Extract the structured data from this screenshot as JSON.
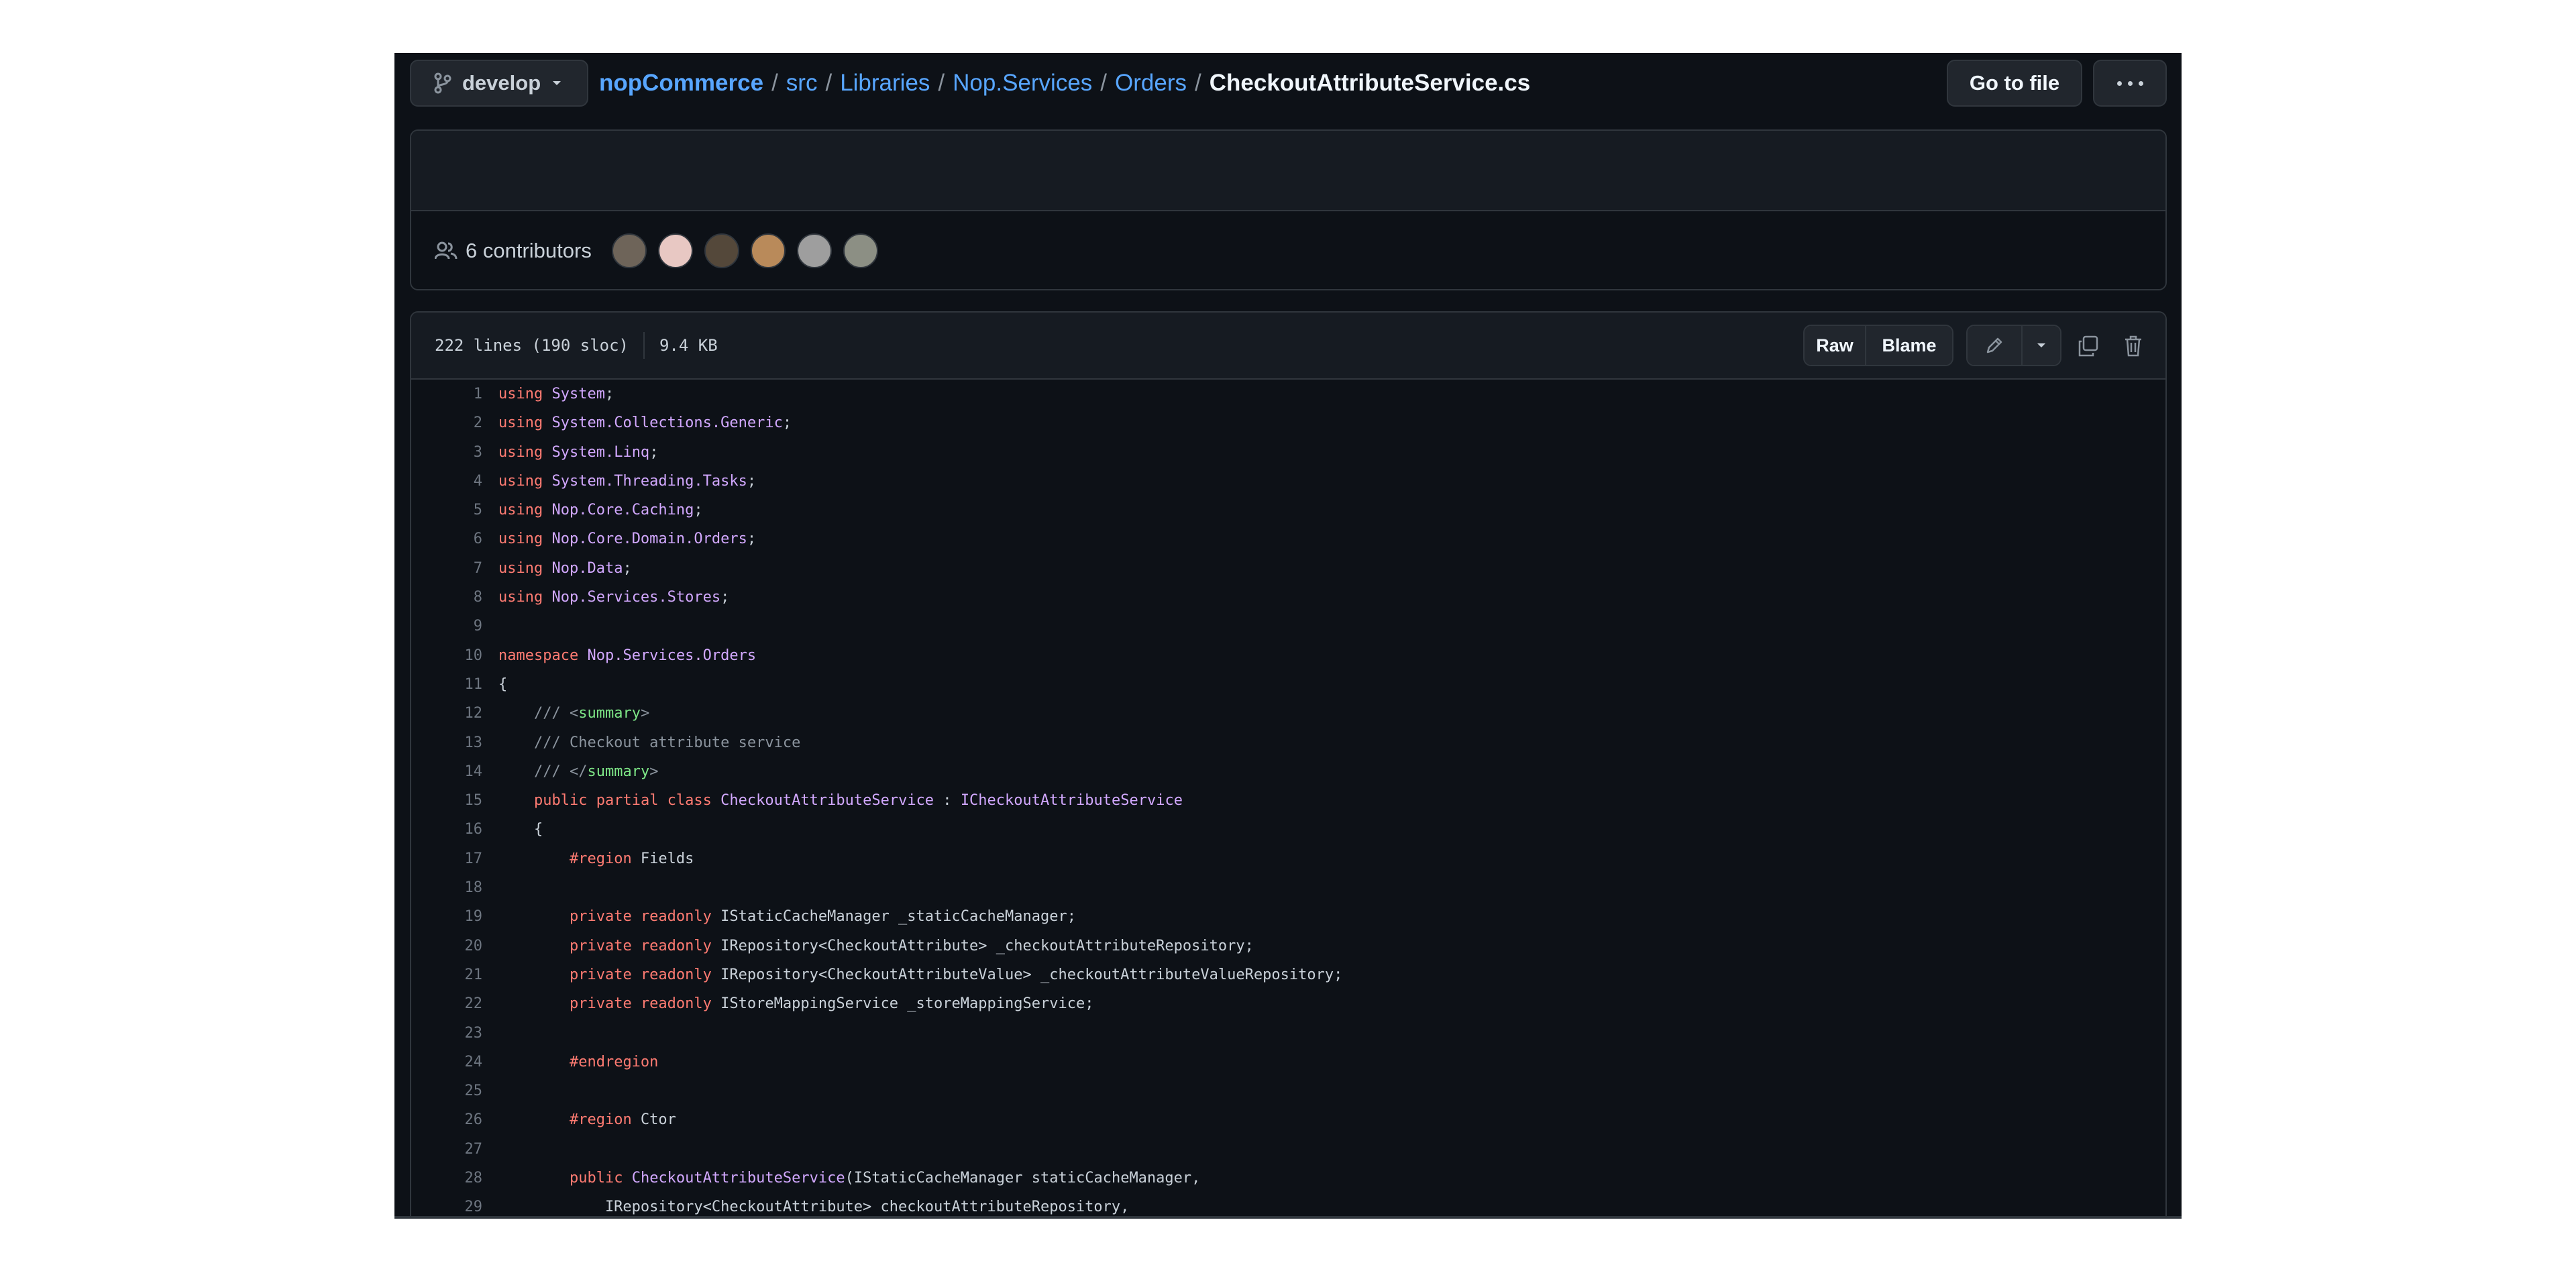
{
  "branch": {
    "name": "develop"
  },
  "breadcrumb": {
    "repo": "nopCommerce",
    "separator": "/",
    "folders": [
      "src",
      "Libraries",
      "Nop.Services",
      "Orders"
    ],
    "file": "CheckoutAttributeService.cs"
  },
  "actions": {
    "goto_file": "Go to file",
    "more": "more-options-icon"
  },
  "contributors": {
    "label": "6 contributors",
    "avatars": [
      "#6e6459",
      "#e8c8c3",
      "#54483a",
      "#b98a5a",
      "#9e9e9e",
      "#8c8f84"
    ]
  },
  "file": {
    "lines_info": "222 lines (190 sloc)",
    "size": "9.4 KB",
    "raw_label": "Raw",
    "blame_label": "Blame"
  },
  "code": [
    {
      "n": "1",
      "tokens": [
        {
          "t": "using",
          "c": "k"
        },
        {
          "t": " "
        },
        {
          "t": "System",
          "c": "n"
        },
        {
          "t": ";"
        }
      ]
    },
    {
      "n": "2",
      "tokens": [
        {
          "t": "using",
          "c": "k"
        },
        {
          "t": " "
        },
        {
          "t": "System.Collections.Generic",
          "c": "n"
        },
        {
          "t": ";"
        }
      ]
    },
    {
      "n": "3",
      "tokens": [
        {
          "t": "using",
          "c": "k"
        },
        {
          "t": " "
        },
        {
          "t": "System.Linq",
          "c": "n"
        },
        {
          "t": ";"
        }
      ]
    },
    {
      "n": "4",
      "tokens": [
        {
          "t": "using",
          "c": "k"
        },
        {
          "t": " "
        },
        {
          "t": "System.Threading.Tasks",
          "c": "n"
        },
        {
          "t": ";"
        }
      ]
    },
    {
      "n": "5",
      "tokens": [
        {
          "t": "using",
          "c": "k"
        },
        {
          "t": " "
        },
        {
          "t": "Nop.Core.Caching",
          "c": "n"
        },
        {
          "t": ";"
        }
      ]
    },
    {
      "n": "6",
      "tokens": [
        {
          "t": "using",
          "c": "k"
        },
        {
          "t": " "
        },
        {
          "t": "Nop.Core.Domain.Orders",
          "c": "n"
        },
        {
          "t": ";"
        }
      ]
    },
    {
      "n": "7",
      "tokens": [
        {
          "t": "using",
          "c": "k"
        },
        {
          "t": " "
        },
        {
          "t": "Nop.Data",
          "c": "n"
        },
        {
          "t": ";"
        }
      ]
    },
    {
      "n": "8",
      "tokens": [
        {
          "t": "using",
          "c": "k"
        },
        {
          "t": " "
        },
        {
          "t": "Nop.Services.Stores",
          "c": "n"
        },
        {
          "t": ";"
        }
      ]
    },
    {
      "n": "9",
      "tokens": []
    },
    {
      "n": "10",
      "tokens": [
        {
          "t": "namespace",
          "c": "k"
        },
        {
          "t": " "
        },
        {
          "t": "Nop.Services.Orders",
          "c": "n"
        }
      ]
    },
    {
      "n": "11",
      "tokens": [
        {
          "t": "{"
        }
      ]
    },
    {
      "n": "12",
      "tokens": [
        {
          "t": "    /// ",
          "c": "c"
        },
        {
          "t": "<",
          "c": "c"
        },
        {
          "t": "summary",
          "c": "t"
        },
        {
          "t": ">",
          "c": "c"
        }
      ]
    },
    {
      "n": "13",
      "tokens": [
        {
          "t": "    /// Checkout attribute service",
          "c": "c"
        }
      ]
    },
    {
      "n": "14",
      "tokens": [
        {
          "t": "    /// ",
          "c": "c"
        },
        {
          "t": "</",
          "c": "c"
        },
        {
          "t": "summary",
          "c": "t"
        },
        {
          "t": ">",
          "c": "c"
        }
      ]
    },
    {
      "n": "15",
      "tokens": [
        {
          "t": "    "
        },
        {
          "t": "public",
          "c": "k"
        },
        {
          "t": " "
        },
        {
          "t": "partial",
          "c": "k"
        },
        {
          "t": " "
        },
        {
          "t": "class",
          "c": "k"
        },
        {
          "t": " "
        },
        {
          "t": "CheckoutAttributeService",
          "c": "n"
        },
        {
          "t": " : "
        },
        {
          "t": "ICheckoutAttributeService",
          "c": "n"
        }
      ]
    },
    {
      "n": "16",
      "tokens": [
        {
          "t": "    {"
        }
      ]
    },
    {
      "n": "17",
      "tokens": [
        {
          "t": "        "
        },
        {
          "t": "#region",
          "c": "k"
        },
        {
          "t": " Fields"
        }
      ]
    },
    {
      "n": "18",
      "tokens": []
    },
    {
      "n": "19",
      "tokens": [
        {
          "t": "        "
        },
        {
          "t": "private",
          "c": "k"
        },
        {
          "t": " "
        },
        {
          "t": "readonly",
          "c": "k"
        },
        {
          "t": " IStaticCacheManager _staticCacheManager;"
        }
      ]
    },
    {
      "n": "20",
      "tokens": [
        {
          "t": "        "
        },
        {
          "t": "private",
          "c": "k"
        },
        {
          "t": " "
        },
        {
          "t": "readonly",
          "c": "k"
        },
        {
          "t": " IRepository<CheckoutAttribute> _checkoutAttributeRepository;"
        }
      ]
    },
    {
      "n": "21",
      "tokens": [
        {
          "t": "        "
        },
        {
          "t": "private",
          "c": "k"
        },
        {
          "t": " "
        },
        {
          "t": "readonly",
          "c": "k"
        },
        {
          "t": " IRepository<CheckoutAttributeValue> _checkoutAttributeValueRepository;"
        }
      ]
    },
    {
      "n": "22",
      "tokens": [
        {
          "t": "        "
        },
        {
          "t": "private",
          "c": "k"
        },
        {
          "t": " "
        },
        {
          "t": "readonly",
          "c": "k"
        },
        {
          "t": " IStoreMappingService _storeMappingService;"
        }
      ]
    },
    {
      "n": "23",
      "tokens": []
    },
    {
      "n": "24",
      "tokens": [
        {
          "t": "        "
        },
        {
          "t": "#endregion",
          "c": "k"
        }
      ]
    },
    {
      "n": "25",
      "tokens": []
    },
    {
      "n": "26",
      "tokens": [
        {
          "t": "        "
        },
        {
          "t": "#region",
          "c": "k"
        },
        {
          "t": " Ctor"
        }
      ]
    },
    {
      "n": "27",
      "tokens": []
    },
    {
      "n": "28",
      "tokens": [
        {
          "t": "        "
        },
        {
          "t": "public",
          "c": "k"
        },
        {
          "t": " "
        },
        {
          "t": "CheckoutAttributeService",
          "c": "n"
        },
        {
          "t": "(IStaticCacheManager staticCacheManager,"
        }
      ]
    },
    {
      "n": "29",
      "tokens": [
        {
          "t": "            IRepository<CheckoutAttribute> checkoutAttributeRepository,"
        }
      ]
    }
  ]
}
